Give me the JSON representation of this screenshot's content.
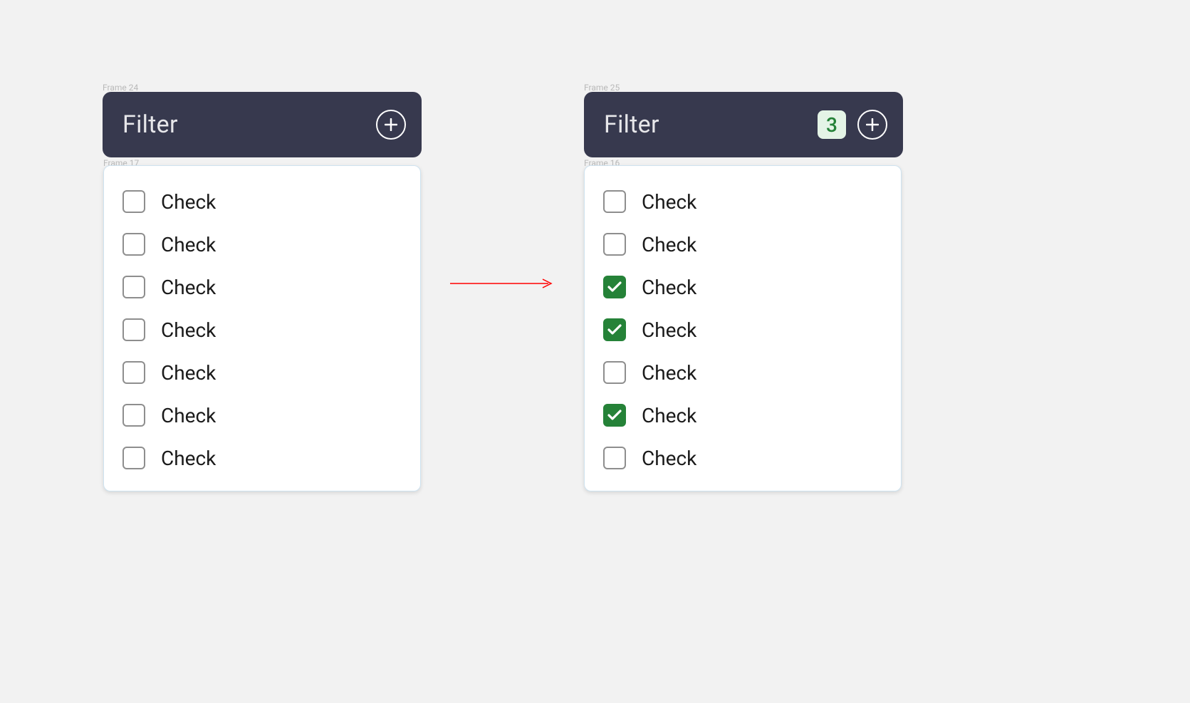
{
  "frames": {
    "left_header_label": "Frame 24",
    "right_header_label": "Frame 25",
    "left_panel_label": "Frame 17",
    "right_panel_label": "Frame 16"
  },
  "filter": {
    "title": "Filter"
  },
  "right_header": {
    "badge_count": "3"
  },
  "left_panel": {
    "items": [
      {
        "label": "Check",
        "checked": false
      },
      {
        "label": "Check",
        "checked": false
      },
      {
        "label": "Check",
        "checked": false
      },
      {
        "label": "Check",
        "checked": false
      },
      {
        "label": "Check",
        "checked": false
      },
      {
        "label": "Check",
        "checked": false
      },
      {
        "label": "Check",
        "checked": false
      }
    ]
  },
  "right_panel": {
    "items": [
      {
        "label": "Check",
        "checked": false
      },
      {
        "label": "Check",
        "checked": false
      },
      {
        "label": "Check",
        "checked": true
      },
      {
        "label": "Check",
        "checked": true
      },
      {
        "label": "Check",
        "checked": false
      },
      {
        "label": "Check",
        "checked": true
      },
      {
        "label": "Check",
        "checked": false
      }
    ]
  }
}
